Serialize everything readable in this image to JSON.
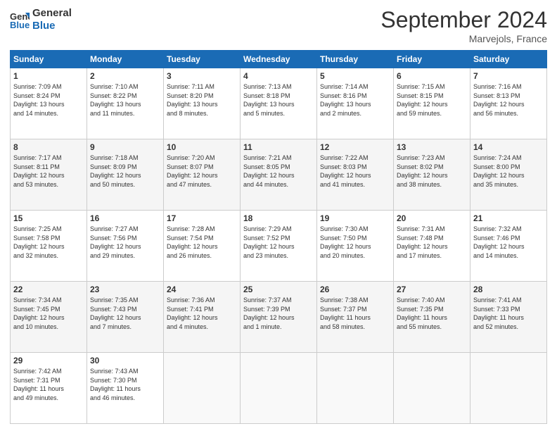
{
  "header": {
    "logo_general": "General",
    "logo_blue": "Blue",
    "month_title": "September 2024",
    "location": "Marvejols, France"
  },
  "weekdays": [
    "Sunday",
    "Monday",
    "Tuesday",
    "Wednesday",
    "Thursday",
    "Friday",
    "Saturday"
  ],
  "weeks": [
    [
      {
        "day": "1",
        "info": "Sunrise: 7:09 AM\nSunset: 8:24 PM\nDaylight: 13 hours\nand 14 minutes."
      },
      {
        "day": "2",
        "info": "Sunrise: 7:10 AM\nSunset: 8:22 PM\nDaylight: 13 hours\nand 11 minutes."
      },
      {
        "day": "3",
        "info": "Sunrise: 7:11 AM\nSunset: 8:20 PM\nDaylight: 13 hours\nand 8 minutes."
      },
      {
        "day": "4",
        "info": "Sunrise: 7:13 AM\nSunset: 8:18 PM\nDaylight: 13 hours\nand 5 minutes."
      },
      {
        "day": "5",
        "info": "Sunrise: 7:14 AM\nSunset: 8:16 PM\nDaylight: 13 hours\nand 2 minutes."
      },
      {
        "day": "6",
        "info": "Sunrise: 7:15 AM\nSunset: 8:15 PM\nDaylight: 12 hours\nand 59 minutes."
      },
      {
        "day": "7",
        "info": "Sunrise: 7:16 AM\nSunset: 8:13 PM\nDaylight: 12 hours\nand 56 minutes."
      }
    ],
    [
      {
        "day": "8",
        "info": "Sunrise: 7:17 AM\nSunset: 8:11 PM\nDaylight: 12 hours\nand 53 minutes."
      },
      {
        "day": "9",
        "info": "Sunrise: 7:18 AM\nSunset: 8:09 PM\nDaylight: 12 hours\nand 50 minutes."
      },
      {
        "day": "10",
        "info": "Sunrise: 7:20 AM\nSunset: 8:07 PM\nDaylight: 12 hours\nand 47 minutes."
      },
      {
        "day": "11",
        "info": "Sunrise: 7:21 AM\nSunset: 8:05 PM\nDaylight: 12 hours\nand 44 minutes."
      },
      {
        "day": "12",
        "info": "Sunrise: 7:22 AM\nSunset: 8:03 PM\nDaylight: 12 hours\nand 41 minutes."
      },
      {
        "day": "13",
        "info": "Sunrise: 7:23 AM\nSunset: 8:02 PM\nDaylight: 12 hours\nand 38 minutes."
      },
      {
        "day": "14",
        "info": "Sunrise: 7:24 AM\nSunset: 8:00 PM\nDaylight: 12 hours\nand 35 minutes."
      }
    ],
    [
      {
        "day": "15",
        "info": "Sunrise: 7:25 AM\nSunset: 7:58 PM\nDaylight: 12 hours\nand 32 minutes."
      },
      {
        "day": "16",
        "info": "Sunrise: 7:27 AM\nSunset: 7:56 PM\nDaylight: 12 hours\nand 29 minutes."
      },
      {
        "day": "17",
        "info": "Sunrise: 7:28 AM\nSunset: 7:54 PM\nDaylight: 12 hours\nand 26 minutes."
      },
      {
        "day": "18",
        "info": "Sunrise: 7:29 AM\nSunset: 7:52 PM\nDaylight: 12 hours\nand 23 minutes."
      },
      {
        "day": "19",
        "info": "Sunrise: 7:30 AM\nSunset: 7:50 PM\nDaylight: 12 hours\nand 20 minutes."
      },
      {
        "day": "20",
        "info": "Sunrise: 7:31 AM\nSunset: 7:48 PM\nDaylight: 12 hours\nand 17 minutes."
      },
      {
        "day": "21",
        "info": "Sunrise: 7:32 AM\nSunset: 7:46 PM\nDaylight: 12 hours\nand 14 minutes."
      }
    ],
    [
      {
        "day": "22",
        "info": "Sunrise: 7:34 AM\nSunset: 7:45 PM\nDaylight: 12 hours\nand 10 minutes."
      },
      {
        "day": "23",
        "info": "Sunrise: 7:35 AM\nSunset: 7:43 PM\nDaylight: 12 hours\nand 7 minutes."
      },
      {
        "day": "24",
        "info": "Sunrise: 7:36 AM\nSunset: 7:41 PM\nDaylight: 12 hours\nand 4 minutes."
      },
      {
        "day": "25",
        "info": "Sunrise: 7:37 AM\nSunset: 7:39 PM\nDaylight: 12 hours\nand 1 minute."
      },
      {
        "day": "26",
        "info": "Sunrise: 7:38 AM\nSunset: 7:37 PM\nDaylight: 11 hours\nand 58 minutes."
      },
      {
        "day": "27",
        "info": "Sunrise: 7:40 AM\nSunset: 7:35 PM\nDaylight: 11 hours\nand 55 minutes."
      },
      {
        "day": "28",
        "info": "Sunrise: 7:41 AM\nSunset: 7:33 PM\nDaylight: 11 hours\nand 52 minutes."
      }
    ],
    [
      {
        "day": "29",
        "info": "Sunrise: 7:42 AM\nSunset: 7:31 PM\nDaylight: 11 hours\nand 49 minutes."
      },
      {
        "day": "30",
        "info": "Sunrise: 7:43 AM\nSunset: 7:30 PM\nDaylight: 11 hours\nand 46 minutes."
      },
      {
        "day": "",
        "info": ""
      },
      {
        "day": "",
        "info": ""
      },
      {
        "day": "",
        "info": ""
      },
      {
        "day": "",
        "info": ""
      },
      {
        "day": "",
        "info": ""
      }
    ]
  ]
}
